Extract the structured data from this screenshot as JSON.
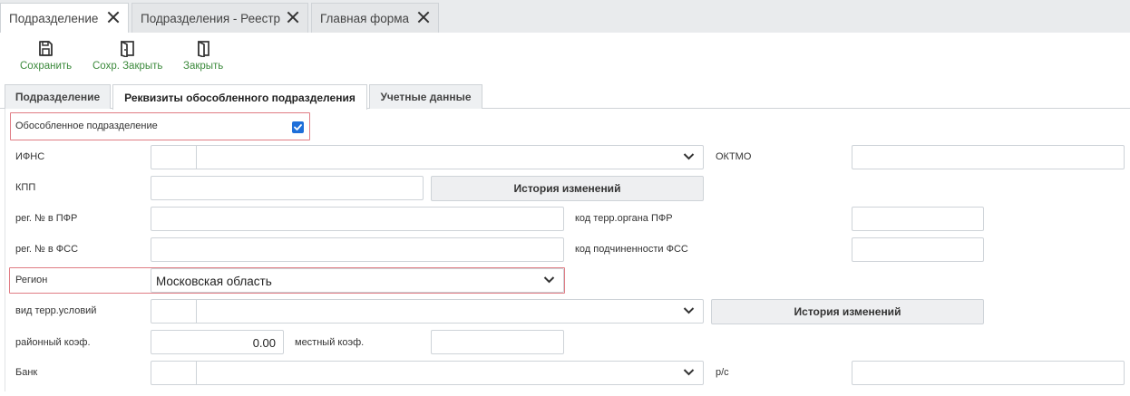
{
  "doc_tabs": [
    {
      "label": "Подразделение",
      "active": true
    },
    {
      "label": "Подразделения - Реестр",
      "active": false
    },
    {
      "label": "Главная форма",
      "active": false
    }
  ],
  "toolbar": {
    "save_label": "Сохранить",
    "save_close_label": "Сохр. Закрыть",
    "close_label": "Закрыть",
    "accent": "#3c8a3c"
  },
  "section_tabs": [
    {
      "label": "Подразделение",
      "active": false
    },
    {
      "label": "Реквизиты обособленного подразделения",
      "active": true
    },
    {
      "label": "Учетные данные",
      "active": false
    }
  ],
  "form": {
    "separate_unit_label": "Обособленное подразделение",
    "separate_unit_checked": true,
    "ifns_label": "ИФНС",
    "ifns_code": "",
    "ifns_value": "",
    "oktmo_label": "ОКТМО",
    "oktmo_value": "",
    "kpp_label": "КПП",
    "kpp_value": "",
    "history_label": "История изменений",
    "pfr_reg_label": "рег. № в ПФР",
    "pfr_reg_value": "",
    "pfr_terr_label": "код терр.органа ПФР",
    "pfr_terr_value": "",
    "fss_reg_label": "рег. № в ФСС",
    "fss_reg_value": "",
    "fss_sub_label": "код подчиненности ФСС",
    "fss_sub_value": "",
    "region_label": "Регион",
    "region_value": "Московская область",
    "terr_cond_label": "вид терр.условий",
    "terr_cond_code": "",
    "terr_cond_value": "",
    "history2_label": "История изменений",
    "district_coef_label": "районный коэф.",
    "district_coef_value": "0.00",
    "local_coef_label": "местный коэф.",
    "local_coef_value": "",
    "bank_label": "Банк",
    "bank_code": "",
    "bank_value": "",
    "account_label": "р/с",
    "account_value": "",
    "highlight_color": "#e07c84",
    "checkbox_color": "#1e6fd9"
  }
}
